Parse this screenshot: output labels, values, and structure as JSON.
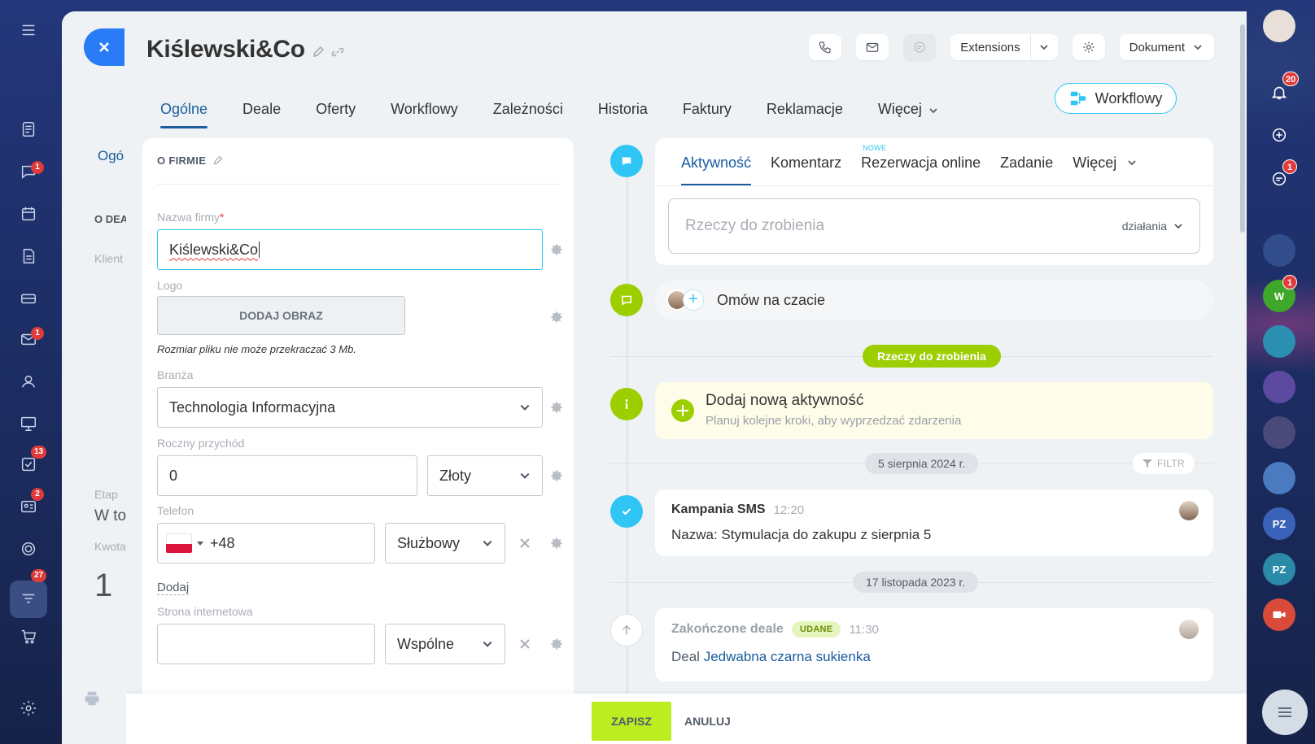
{
  "company_name": "Kiślewski&Co",
  "header": {
    "extensions_label": "Extensions",
    "document_label": "Dokument"
  },
  "tabs": [
    {
      "label": "Ogólne",
      "active": true
    },
    {
      "label": "Deale"
    },
    {
      "label": "Oferty"
    },
    {
      "label": "Workflowy"
    },
    {
      "label": "Zależności"
    },
    {
      "label": "Historia"
    },
    {
      "label": "Faktury"
    },
    {
      "label": "Reklamacje"
    },
    {
      "label": "Więcej",
      "has_dropdown": true
    }
  ],
  "workflow_button": {
    "label": "Workflowy"
  },
  "form": {
    "section_title": "O FIRMIE",
    "company_name_label": "Nazwa firmy",
    "company_name_required": "*",
    "company_name_value": "Kiślewski&Co",
    "logo_label": "Logo",
    "add_image_label": "DODAJ OBRAZ",
    "file_hint": "Rozmiar pliku nie może przekraczać 3 Mb.",
    "industry_label": "Branża",
    "industry_value": "Technologia Informacyjna",
    "revenue_label": "Roczny przychód",
    "revenue_value": "0",
    "currency_value": "Złoty",
    "phone_label": "Telefon",
    "phone_value": "+48",
    "phone_type_value": "Służbowy",
    "add_link": "Dodaj",
    "website_label": "Strona internetowa",
    "website_value": "",
    "website_type_value": "Wspólne"
  },
  "activity": {
    "tabs": [
      {
        "label": "Aktywność",
        "active": true
      },
      {
        "label": "Komentarz"
      },
      {
        "label": "Rezerwacja online",
        "tag": "NOWE"
      },
      {
        "label": "Zadanie"
      },
      {
        "label": "Więcej",
        "has_dropdown": true
      }
    ],
    "todo_placeholder": "Rzeczy do zrobienia",
    "actions_label": "działania"
  },
  "chat_row": {
    "label": "Omów na czacie"
  },
  "todo_pill": "Rzeczy do zrobienia",
  "add_activity": {
    "title": "Dodaj nową aktywność",
    "subtitle": "Planuj kolejne kroki, aby wyprzedzać zdarzenia"
  },
  "timeline": {
    "filter_label": "FILTR",
    "groups": [
      {
        "date": "5 sierpnia 2024 r.",
        "event": {
          "title": "Kampania SMS",
          "time": "12:20",
          "body": "Nazwa: Stymulacja do zakupu z sierpnia 5"
        }
      },
      {
        "date": "17 listopada 2023 r.",
        "event": {
          "title": "Zakończone deale",
          "badge": "UDANE",
          "time": "11:30",
          "body_prefix": "Deal",
          "body_link": "Jedwabna czarna sukienka"
        }
      }
    ]
  },
  "bottom": {
    "save_label": "ZAPISZ",
    "cancel_label": "ANULUJ"
  },
  "left_rail_badges": [
    "1",
    "1",
    "13",
    "2",
    "27"
  ],
  "right_rail": {
    "notifications_badge": "20",
    "messages_badge": "1",
    "avatar_letter": "W",
    "avatar_letter_badge": "1",
    "pz_1": "PZ",
    "pz_2": "PZ"
  },
  "background_panel": {
    "tab_fragment": "Ogó",
    "section_fragment": "O DEA",
    "client_fragment": "Klient",
    "stage_fragment": "Etap",
    "stage_value_fragment": "W to",
    "amount_fragment": "Kwota",
    "amount_value_fragment": "1"
  },
  "colors": {
    "accent_blue": "#2fc6f6",
    "link_blue": "#1a5c9e",
    "green": "#9dcf00",
    "save_green": "#bbed21",
    "badge_red": "#e03b3b"
  }
}
